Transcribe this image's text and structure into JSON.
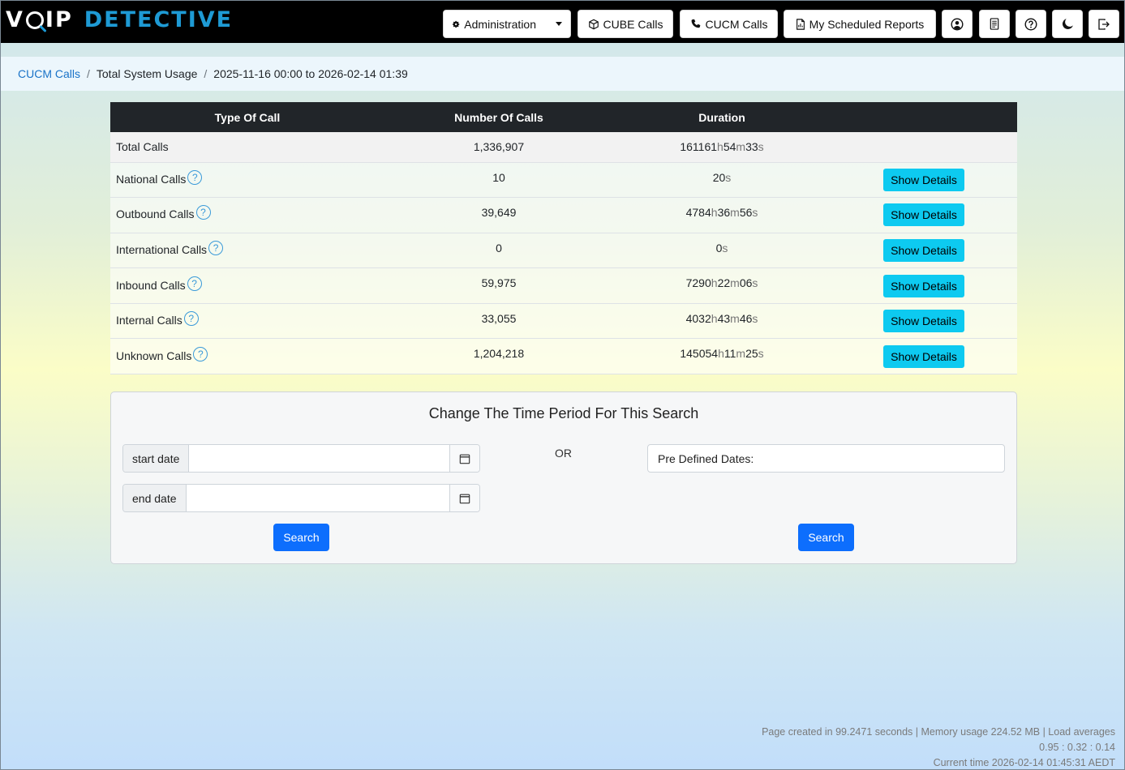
{
  "app": {
    "logo_voip_v": "V",
    "logo_voip_rest": "IP",
    "logo_detective": "DETECTIVE"
  },
  "nav": {
    "administration": "Administration",
    "cube_calls": "CUBE Calls",
    "cucm_calls": "CUCM Calls",
    "scheduled_reports": "My Scheduled Reports",
    "icons": [
      "user-circle-icon",
      "report-doc-icon",
      "help-circle-icon",
      "moon-icon",
      "logout-icon"
    ]
  },
  "breadcrumb": {
    "root": "CUCM Calls",
    "section": "Total System Usage",
    "range": "2025-11-16 00:00 to 2026-02-14 01:39"
  },
  "table": {
    "headers": {
      "type": "Type Of Call",
      "count": "Number Of Calls",
      "duration": "Duration"
    },
    "total": {
      "label": "Total Calls",
      "count": "1,336,907",
      "h": "161161",
      "m": "54",
      "s": "33"
    },
    "rows": [
      {
        "label": "National Calls",
        "count": "10",
        "h": "",
        "m": "",
        "s": "20"
      },
      {
        "label": "Outbound Calls",
        "count": "39,649",
        "h": "4784",
        "m": "36",
        "s": "56"
      },
      {
        "label": "International Calls",
        "count": "0",
        "h": "",
        "m": "",
        "s": "0"
      },
      {
        "label": "Inbound Calls",
        "count": "59,975",
        "h": "7290",
        "m": "22",
        "s": "06"
      },
      {
        "label": "Internal Calls",
        "count": "33,055",
        "h": "4032",
        "m": "43",
        "s": "46"
      },
      {
        "label": "Unknown Calls",
        "count": "1,204,218",
        "h": "145054",
        "m": "11",
        "s": "25"
      }
    ],
    "units": {
      "h": "h",
      "m": "m",
      "s": "s"
    },
    "help_glyph": "?",
    "show_details": "Show Details"
  },
  "form": {
    "title": "Change The Time Period For This Search",
    "start_label": "start date",
    "end_label": "end date",
    "start_value": "",
    "end_value": "",
    "or": "OR",
    "predefined_label": "Pre Defined Dates:",
    "search_label": "Search"
  },
  "footer": {
    "line1": "Page created in 99.2471 seconds | Memory usage 224.52 MB | Load averages",
    "line2": "0.95 : 0.32 : 0.14",
    "line3": "Current time 2026-02-14 01:45:31 AEDT"
  }
}
